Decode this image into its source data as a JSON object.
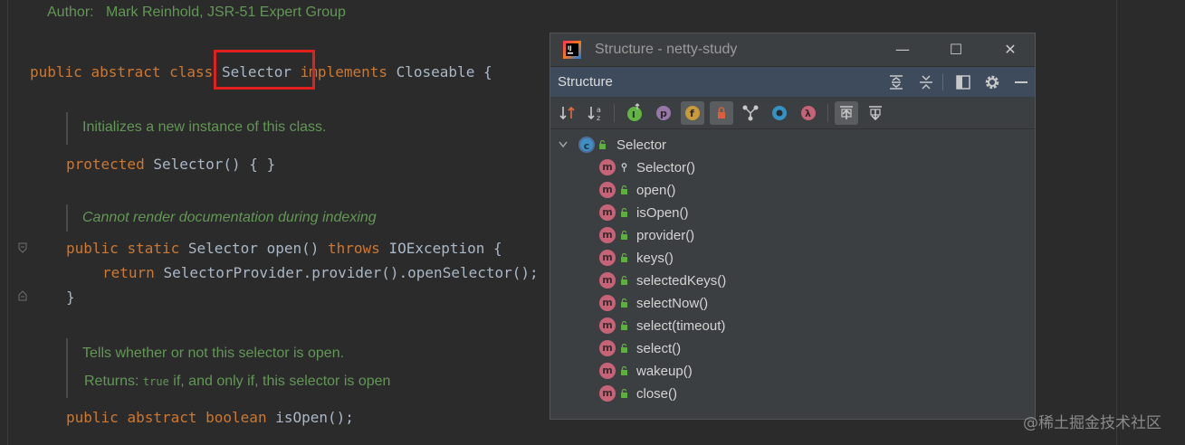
{
  "editor": {
    "author_label": "Author:",
    "author_value": "Mark Reinhold, JSR-51 Expert Group",
    "class_decl": {
      "kw1": "public",
      "kw2": "abstract",
      "kw3": "class",
      "name": "Selector",
      "kw4": "implements",
      "iface": "Closeable",
      "brace": "{"
    },
    "doc1": "Initializes a new instance of this class.",
    "ctor": {
      "kw": "protected",
      "sig": "Selector() { }"
    },
    "doc2": "Cannot render documentation during indexing",
    "open_decl": {
      "kw1": "public",
      "kw2": "static",
      "type": "Selector",
      "sig": "open()",
      "throws": "throws",
      "ex": "IOException {"
    },
    "open_body": {
      "kw": "return",
      "expr": "SelectorProvider.provider().openSelector();"
    },
    "close_brace": "}",
    "doc3": "Tells whether or not this selector is open.",
    "doc3_returns_label": "Returns:",
    "doc3_returns_code": "true",
    "doc3_returns_text": "if, and only if, this selector is open",
    "isopen_decl": {
      "kw1": "public",
      "kw2": "abstract",
      "kw3": "boolean",
      "sig": "isOpen();"
    }
  },
  "structure_window": {
    "title": "Structure - netty-study",
    "controls": {
      "minimize": "—",
      "maximize": "☐",
      "close": "✕"
    },
    "header_title": "Structure",
    "root": {
      "label": "Selector",
      "icon": "class-icon"
    },
    "members": [
      {
        "label": "Selector()",
        "icon": "method-icon",
        "visibility": "protected"
      },
      {
        "label": "open()",
        "icon": "method-icon",
        "visibility": "public"
      },
      {
        "label": "isOpen()",
        "icon": "method-icon",
        "visibility": "public"
      },
      {
        "label": "provider()",
        "icon": "method-icon",
        "visibility": "public"
      },
      {
        "label": "keys()",
        "icon": "method-icon",
        "visibility": "public"
      },
      {
        "label": "selectedKeys()",
        "icon": "method-icon",
        "visibility": "public"
      },
      {
        "label": "selectNow()",
        "icon": "method-icon",
        "visibility": "public"
      },
      {
        "label": "select(timeout)",
        "icon": "method-icon",
        "visibility": "public"
      },
      {
        "label": "select()",
        "icon": "method-icon",
        "visibility": "public"
      },
      {
        "label": "wakeup()",
        "icon": "method-icon",
        "visibility": "public"
      },
      {
        "label": "close()",
        "icon": "method-icon",
        "visibility": "public"
      }
    ],
    "badge_m": "m",
    "badge_c": "c"
  },
  "colors": {
    "keyword": "#cc7832",
    "doc": "#629755",
    "header_bg": "#3d4b5c",
    "highlight": "#e0201c"
  },
  "watermark": "@稀土掘金技术社区"
}
